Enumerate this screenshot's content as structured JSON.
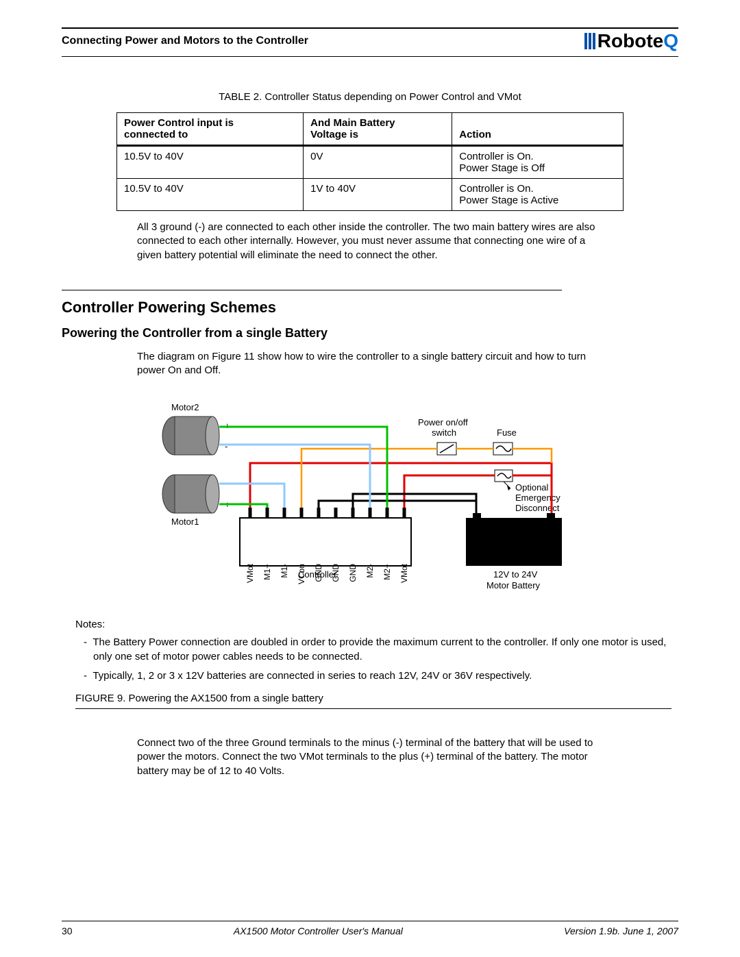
{
  "header": {
    "section_title": "Connecting Power and Motors to the Controller",
    "brand": "Robote",
    "brand_q": "Q"
  },
  "table": {
    "caption": "TABLE 2. Controller Status depending on Power Control and VMot",
    "headers": {
      "c1a": "Power Control input is",
      "c1b": "connected to",
      "c2a": "And Main Battery",
      "c2b": "Voltage is",
      "c3": "Action"
    },
    "rows": [
      {
        "c1": "10.5V to 40V",
        "c2": "0V",
        "c3a": "Controller is On.",
        "c3b": "Power Stage is Off"
      },
      {
        "c1": "10.5V to 40V",
        "c2": "1V to 40V",
        "c3a": "Controller is On.",
        "c3b": "Power Stage is Active"
      }
    ]
  },
  "paragraph_after_table": "All 3 ground (-) are connected to each other inside the controller. The two main battery wires are also connected to each other internally. However, you must never assume that connecting one wire of a given battery potential will eliminate the need to connect the other.",
  "section_heading": "Controller Powering Schemes",
  "subsection_heading": "Powering the Controller from a single Battery",
  "subsection_para": "The diagram on Figure 11 show how to wire the controller to a single battery circuit and how to turn power On and Off.",
  "figure": {
    "motor2_label": "Motor2",
    "motor1_label": "Motor1",
    "power_switch_label": "Power on/off\nswitch",
    "fuse_label": "Fuse",
    "optional_label": "Optional\nEmergency\nDisconnect",
    "controller_label": "Controller",
    "battery_label": "12V to 24V\nMotor Battery",
    "terminals": [
      "VMot",
      "M1+",
      "M1-",
      "VCon",
      "GND",
      "GND",
      "GND",
      "M2-",
      "M2+",
      "VMot"
    ],
    "m2_plus": "+",
    "m2_minus": "-",
    "m1_minus": "-",
    "m1_plus": "+"
  },
  "notes": {
    "label": "Notes:",
    "items": [
      "The Battery Power connection are doubled in order to provide the maximum current to the controller. If only one motor is used, only one set of motor power cables needs to be connected.",
      "Typically, 1, 2 or 3 x 12V batteries are connected in series to reach 12V, 24V or 36V respectively."
    ]
  },
  "figure_caption": "FIGURE 9.  Powering the AX1500 from a single battery",
  "connect_para": "Connect two of the three Ground terminals to the minus (-) terminal of the battery that will be used to power the motors. Connect the two VMot terminals to the plus (+) terminal of the battery. The motor battery may be of 12 to 40 Volts.",
  "footer": {
    "page": "30",
    "center": "AX1500 Motor Controller User's Manual",
    "right": "Version 1.9b. June 1, 2007"
  }
}
